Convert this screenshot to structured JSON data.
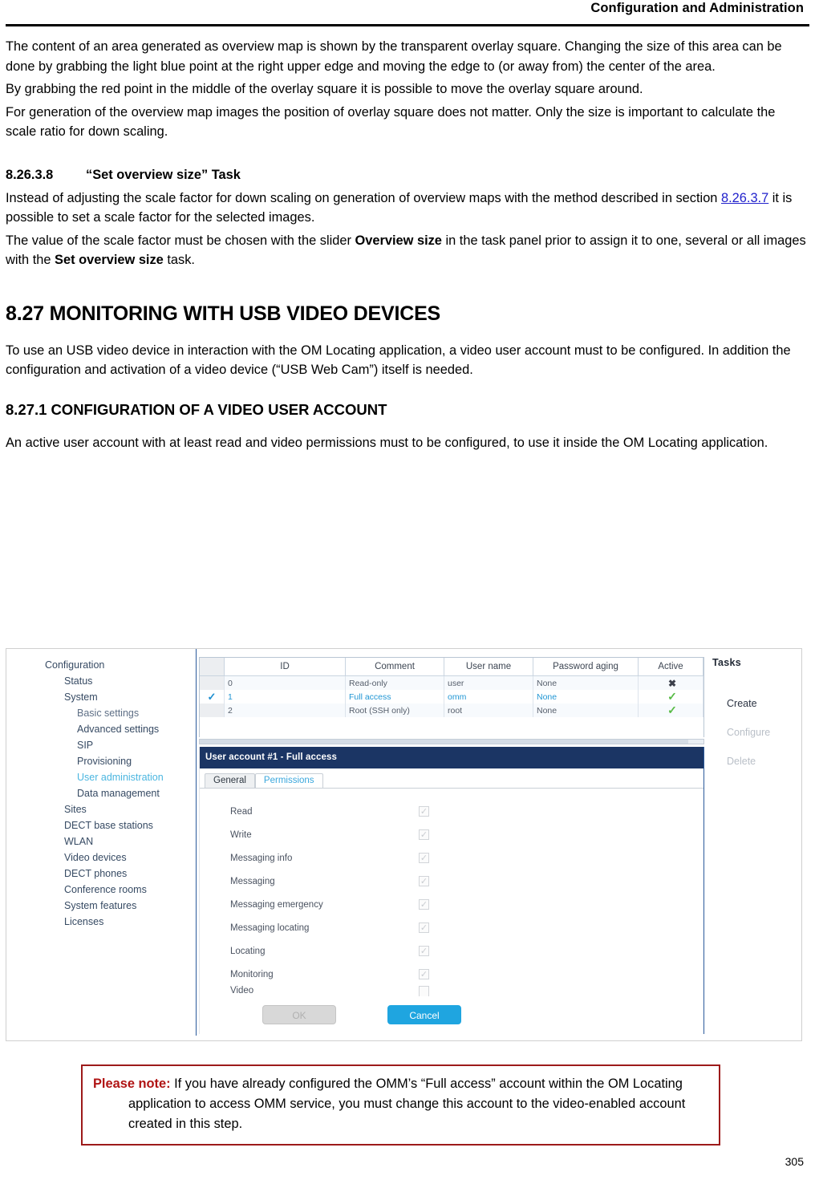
{
  "header": {
    "title": "Configuration and Administration"
  },
  "footer": {
    "page_number": "305"
  },
  "body": {
    "para1": "The content of an area generated as overview map is shown by the transparent overlay square. Changing the size of this area can be done by grabbing the light blue point at the right upper edge and moving the edge to (or away from) the center of the area.",
    "para2": "By grabbing the red point in the middle of the overlay square it is possible to move the overlay square around.",
    "para3": "For generation of the overview map images the position of overlay square does not matter. Only the size is important to calculate the scale ratio for down scaling.",
    "heading_8_26_3_8_num": "8.26.3.8",
    "heading_8_26_3_8_text": "“Set overview size” Task",
    "para4_part1": "Instead of adjusting the scale factor for down scaling on generation of overview maps with the method described in section ",
    "para4_link": "8.26.3.7",
    "para4_part2": " it is possible to set a scale factor for the selected images.",
    "para5_part1": "The value of the scale factor must be chosen with the slider ",
    "para5_bold1": "Overview size",
    "para5_part2": " in the task panel prior to assign it to one, several or all images with the ",
    "para5_bold2": "Set overview size",
    "para5_part3": " task.",
    "heading_8_27": "8.27 MONITORING WITH USB VIDEO DEVICES",
    "para6": "To use an USB video device in interaction with the OM Locating application, a video user account must to be configured. In addition the configuration and activation of a video device (“USB Web Cam”) itself is needed.",
    "heading_8_27_1_num": "8.27.1",
    "heading_8_27_1_text": "CONFIGURATION OF A VIDEO USER ACCOUNT",
    "para7": "An active user account with at least read and video permissions must to be configured, to use it inside the OM Locating application."
  },
  "note": {
    "label": "Please note:",
    "text": " If you have already configured the OMM’s “Full access” account within the OM Locating application to access OMM service, you must change this account to the video-enabled account created in this step."
  },
  "screenshot": {
    "nav": {
      "items": [
        {
          "label": "Configuration",
          "level": 0,
          "state": "normal"
        },
        {
          "label": "Status",
          "level": 1,
          "state": "normal"
        },
        {
          "label": "System",
          "level": 1,
          "state": "normal"
        },
        {
          "label": "Basic settings",
          "level": 2,
          "state": "faint"
        },
        {
          "label": "Advanced settings",
          "level": 2,
          "state": "normal"
        },
        {
          "label": "SIP",
          "level": 2,
          "state": "normal"
        },
        {
          "label": "Provisioning",
          "level": 2,
          "state": "normal"
        },
        {
          "label": "User administration",
          "level": 2,
          "state": "active"
        },
        {
          "label": "Data management",
          "level": 2,
          "state": "normal"
        },
        {
          "label": "Sites",
          "level": 1,
          "state": "normal"
        },
        {
          "label": "DECT base stations",
          "level": 1,
          "state": "normal"
        },
        {
          "label": "WLAN",
          "level": 1,
          "state": "normal"
        },
        {
          "label": "Video devices",
          "level": 1,
          "state": "normal"
        },
        {
          "label": "DECT phones",
          "level": 1,
          "state": "normal"
        },
        {
          "label": "Conference rooms",
          "level": 1,
          "state": "normal"
        },
        {
          "label": "System features",
          "level": 1,
          "state": "normal"
        },
        {
          "label": "Licenses",
          "level": 1,
          "state": "normal"
        }
      ]
    },
    "table": {
      "columns": [
        "",
        "ID",
        "Comment",
        "User name",
        "Password aging",
        "Active"
      ],
      "rows": [
        {
          "selected": false,
          "id": "0",
          "comment": "Read-only",
          "user_name": "user",
          "password_aging": "None",
          "active": "cross"
        },
        {
          "selected": true,
          "id": "1",
          "comment": "Full access",
          "user_name": "omm",
          "password_aging": "None",
          "active": "check"
        },
        {
          "selected": false,
          "id": "2",
          "comment": "Root (SSH only)",
          "user_name": "root",
          "password_aging": "None",
          "active": "check"
        }
      ]
    },
    "detail": {
      "title_main": "User account #1",
      "title_sep": " - ",
      "title_sub": "Full access",
      "tabs": [
        {
          "label": "General",
          "active": false
        },
        {
          "label": "Permissions",
          "active": true
        }
      ],
      "permissions": [
        {
          "label": "Read",
          "checked": true
        },
        {
          "label": "Write",
          "checked": true
        },
        {
          "label": "Messaging info",
          "checked": true
        },
        {
          "label": "Messaging",
          "checked": true
        },
        {
          "label": "Messaging emergency",
          "checked": true
        },
        {
          "label": "Messaging locating",
          "checked": true
        },
        {
          "label": "Messaging locating",
          "checked": true
        },
        {
          "label": "Locating",
          "checked": true
        },
        {
          "label": "Monitoring",
          "checked": true
        },
        {
          "label": "Video",
          "checked": false
        }
      ],
      "ok_label": "OK",
      "cancel_label": "Cancel"
    },
    "tasks": {
      "title": "Tasks",
      "items": [
        {
          "label": "Create",
          "disabled": false
        },
        {
          "label": "Configure",
          "disabled": true
        },
        {
          "label": "Delete",
          "disabled": true
        }
      ]
    },
    "colors": {
      "accent_blue": "#1fa5e0",
      "panel_header": "#1b3564",
      "link_blue": "#2196d4",
      "check_green": "#57bb45",
      "note_red": "#9d1a1a"
    }
  }
}
